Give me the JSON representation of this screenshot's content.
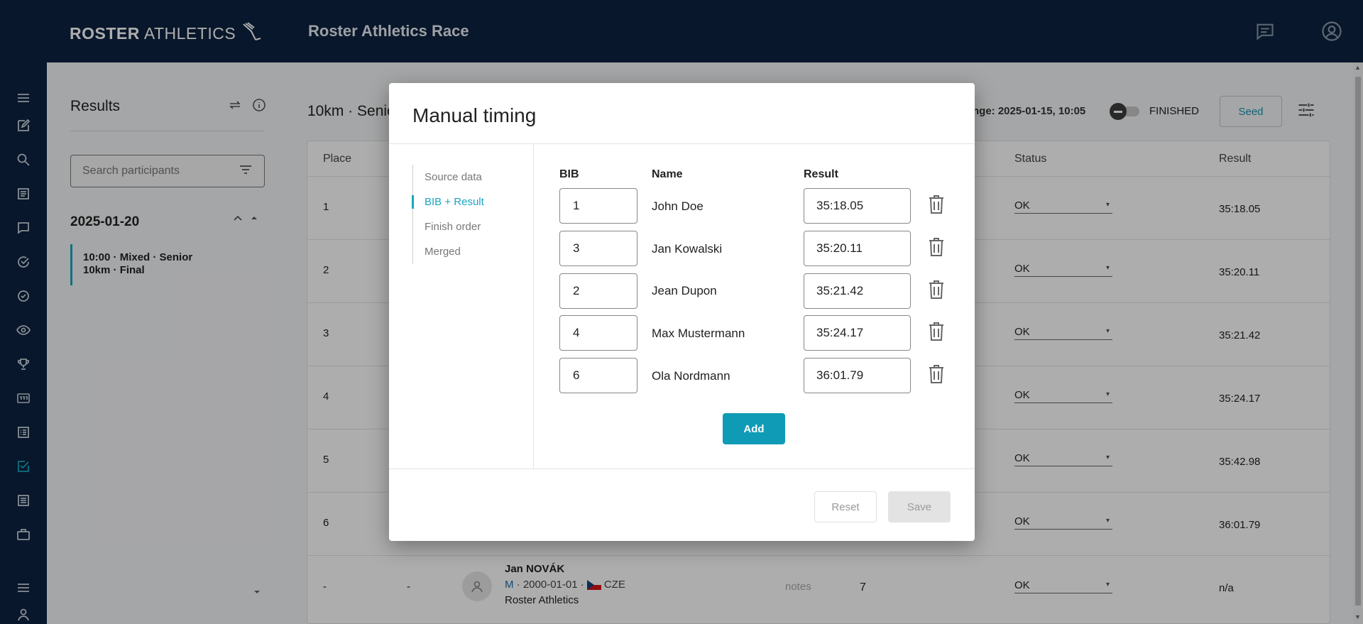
{
  "app": {
    "logo_bold": "ROSTER",
    "logo_light": "ATHLETICS",
    "title": "Roster Athletics Race"
  },
  "sidebar": {
    "title": "Results",
    "search_placeholder": "Search participants",
    "date": "2025-01-20",
    "event_line1": "10:00 · Mixed · Senior",
    "event_line2": "10km · Final"
  },
  "main": {
    "title": "10km · Senio",
    "change_text": "nge: 2025-01-15, 10:05",
    "finished_label": "FINISHED",
    "seed_label": "Seed",
    "columns": {
      "place": "Place",
      "status": "Status",
      "result": "Result"
    },
    "rows": [
      {
        "place": "1",
        "status": "OK",
        "result": "35:18.05"
      },
      {
        "place": "2",
        "status": "OK",
        "result": "35:20.11"
      },
      {
        "place": "3",
        "status": "OK",
        "result": "35:21.42"
      },
      {
        "place": "4",
        "status": "OK",
        "result": "35:24.17"
      },
      {
        "place": "5",
        "status": "OK",
        "result": "35:42.98"
      },
      {
        "place": "6",
        "status": "OK",
        "result": "36:01.79"
      }
    ],
    "last_row": {
      "place": "-",
      "col2": "-",
      "name": "Jan NOVÁK",
      "gender": "M",
      "dob": " · 2000-01-01 · ",
      "country": "CZE",
      "club": "Roster Athletics",
      "notes": "notes",
      "bib": "7",
      "status": "OK",
      "result": "n/a"
    }
  },
  "modal": {
    "title": "Manual timing",
    "nav": [
      "Source data",
      "BIB + Result",
      "Finish order",
      "Merged"
    ],
    "active_nav": 1,
    "columns": {
      "bib": "BIB",
      "name": "Name",
      "result": "Result"
    },
    "entries": [
      {
        "bib": "1",
        "name": "John Doe",
        "result": "35:18.05"
      },
      {
        "bib": "3",
        "name": "Jan Kowalski",
        "result": "35:20.11"
      },
      {
        "bib": "2",
        "name": "Jean Dupon",
        "result": "35:21.42"
      },
      {
        "bib": "4",
        "name": "Max Mustermann",
        "result": "35:24.17"
      },
      {
        "bib": "6",
        "name": "Ola Nordmann",
        "result": "36:01.79"
      }
    ],
    "add_label": "Add",
    "reset_label": "Reset",
    "save_label": "Save"
  },
  "colors": {
    "topbar": "#0c2340",
    "accent": "#1ba5c2",
    "add_button": "#0f9bb6"
  }
}
